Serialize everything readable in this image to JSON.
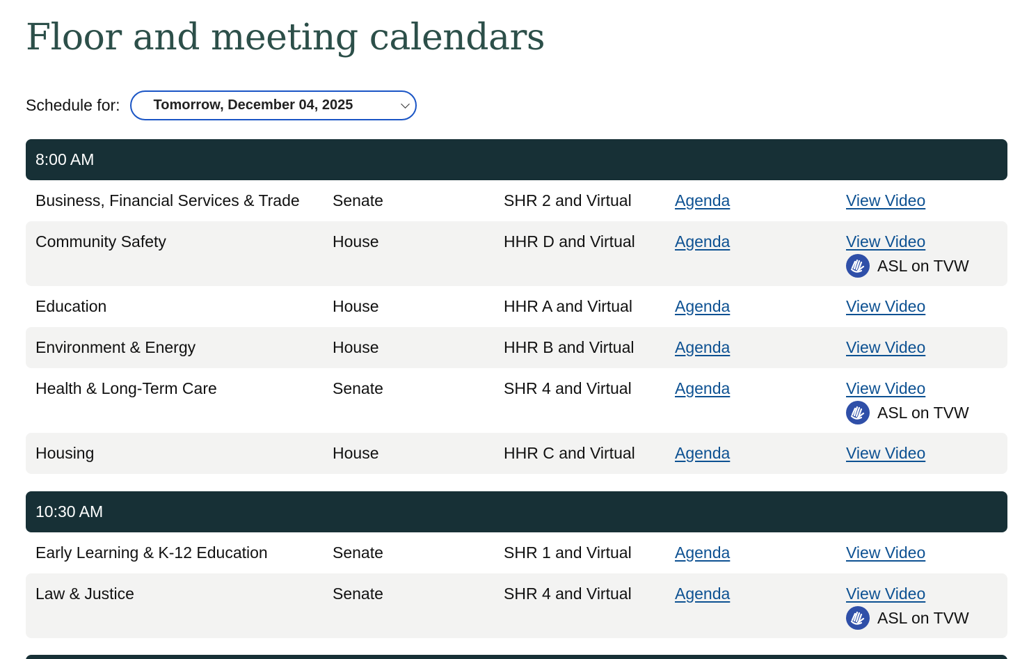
{
  "page_title": "Floor and meeting calendars",
  "schedule": {
    "label": "Schedule for:",
    "selected": "Tomorrow, December 04, 2025"
  },
  "blocks": [
    {
      "time": "8:00 AM",
      "meetings": [
        {
          "name": "Business, Financial Services & Trade",
          "chamber": "Senate",
          "room": "SHR 2 and Virtual",
          "agenda": "Agenda",
          "video": "View Video",
          "asl": ""
        },
        {
          "name": "Community Safety",
          "chamber": "House",
          "room": "HHR D and Virtual",
          "agenda": "Agenda",
          "video": "View Video",
          "asl": "ASL on TVW"
        },
        {
          "name": "Education",
          "chamber": "House",
          "room": "HHR A and Virtual",
          "agenda": "Agenda",
          "video": "View Video",
          "asl": ""
        },
        {
          "name": "Environment & Energy",
          "chamber": "House",
          "room": "HHR B and Virtual",
          "agenda": "Agenda",
          "video": "View Video",
          "asl": ""
        },
        {
          "name": "Health & Long-Term Care",
          "chamber": "Senate",
          "room": "SHR 4 and Virtual",
          "agenda": "Agenda",
          "video": "View Video",
          "asl": "ASL on TVW"
        },
        {
          "name": "Housing",
          "chamber": "House",
          "room": "HHR C and Virtual",
          "agenda": "Agenda",
          "video": "View Video",
          "asl": ""
        }
      ]
    },
    {
      "time": "10:30 AM",
      "meetings": [
        {
          "name": "Early Learning & K-12 Education",
          "chamber": "Senate",
          "room": "SHR 1 and Virtual",
          "agenda": "Agenda",
          "video": "View Video",
          "asl": ""
        },
        {
          "name": "Law & Justice",
          "chamber": "Senate",
          "room": "SHR 4 and Virtual",
          "agenda": "Agenda",
          "video": "View Video",
          "asl": "ASL on TVW"
        }
      ]
    }
  ],
  "icons": {
    "asl": "asl-signing-hands-icon",
    "dropdown": "chevron-down-icon"
  },
  "colors": {
    "title": "#2c4f49",
    "time_header_bg": "#173036",
    "link": "#0d5192",
    "row_shade": "#f3f3f2",
    "select_border": "#1a55c5",
    "asl_icon_bg": "#2f4fa8"
  }
}
